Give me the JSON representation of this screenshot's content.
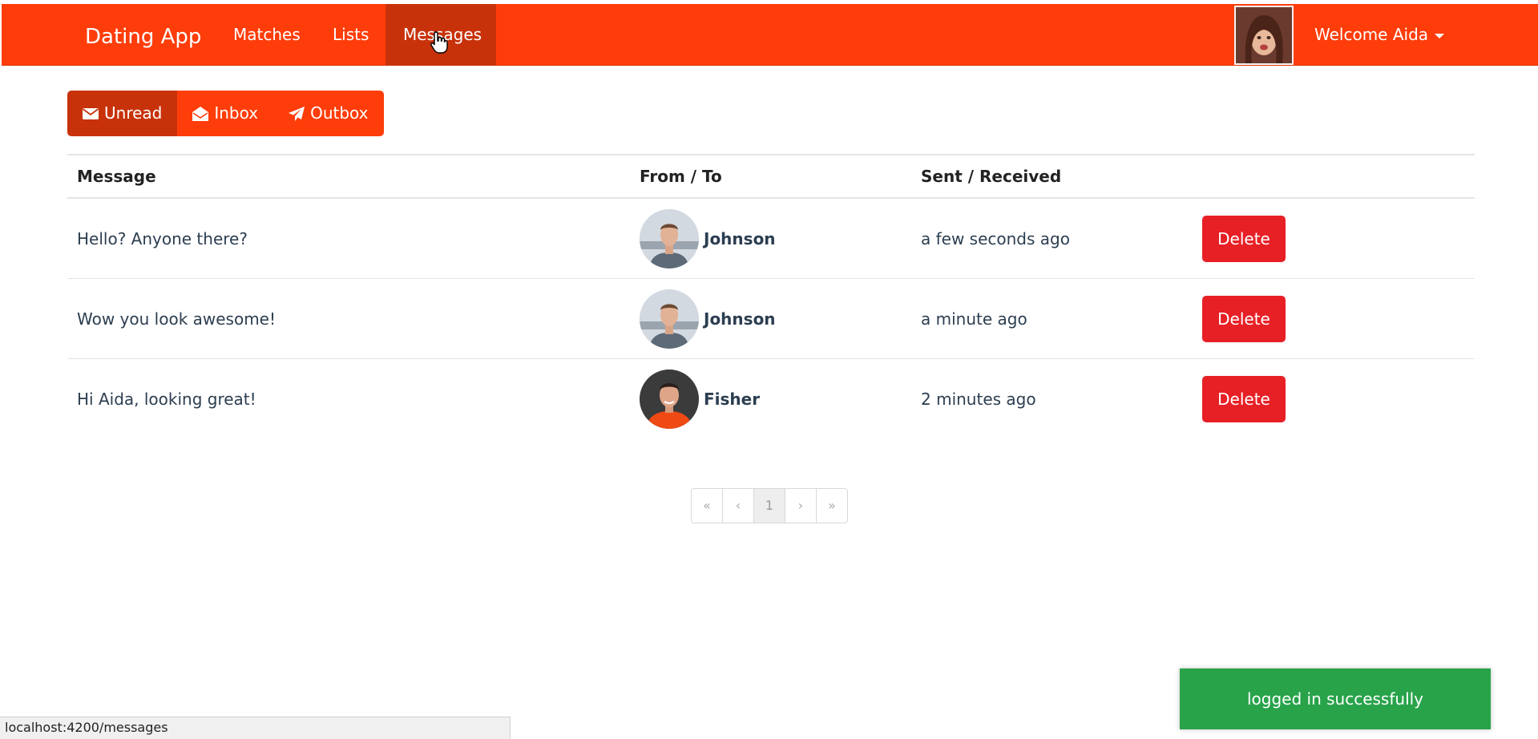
{
  "navbar": {
    "brand": "Dating App",
    "links": [
      {
        "label": "Matches"
      },
      {
        "label": "Lists"
      },
      {
        "label": "Messages"
      }
    ],
    "welcome": "Welcome Aida"
  },
  "tabs": [
    {
      "label": "Unread",
      "icon": "envelope-icon",
      "active": true
    },
    {
      "label": "Inbox",
      "icon": "envelope-open-icon",
      "active": false
    },
    {
      "label": "Outbox",
      "icon": "paper-plane-icon",
      "active": false
    }
  ],
  "table": {
    "headers": {
      "message": "Message",
      "from_to": "From / To",
      "sent_received": "Sent / Received"
    },
    "rows": [
      {
        "message": "Hello? Anyone there?",
        "from": "Johnson",
        "time": "a few seconds ago",
        "action": "Delete"
      },
      {
        "message": "Wow you look awesome!",
        "from": "Johnson",
        "time": "a minute ago",
        "action": "Delete"
      },
      {
        "message": "Hi Aida, looking great!",
        "from": "Fisher",
        "time": "2 minutes ago",
        "action": "Delete"
      }
    ]
  },
  "pagination": {
    "first": "«",
    "prev": "‹",
    "current": "1",
    "next": "›",
    "last": "»"
  },
  "toast": "logged in successfully",
  "status_url": "localhost:4200/messages",
  "colors": {
    "primary": "#ff3d0a",
    "primary_active": "#c8320a",
    "danger": "#e72026",
    "success": "#28a34a"
  }
}
